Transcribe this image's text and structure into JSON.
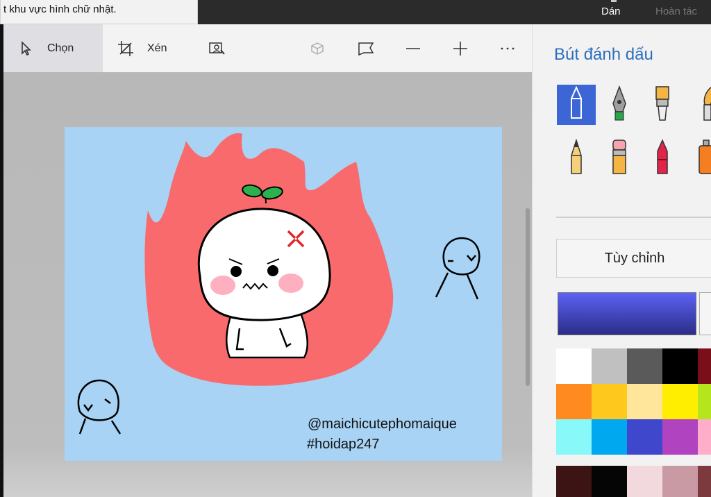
{
  "tooltip": {
    "text": "t khu vực hình chữ nhật."
  },
  "topbar": {
    "paste_label": "Dán",
    "undo_label": "Hoàn tác"
  },
  "toolbar": {
    "select_label": "Chọn",
    "crop_label": "Xén"
  },
  "canvas": {
    "watermark_line1": "@maichicutephomaique",
    "watermark_line2": "#hoidap247"
  },
  "panel": {
    "title": "Bút đánh dấu",
    "brushes": [
      "marker",
      "calligraphy-pen",
      "oil-brush",
      "watercolor-brush",
      "pencil",
      "eraser",
      "crayon",
      "spray-can"
    ],
    "customize_label": "Tùy chỉnh",
    "current_color": "#4a50d8",
    "palette": [
      [
        "#ffffff",
        "#c0c0c0",
        "#5a5a5a",
        "#000000",
        "#7a0f1a"
      ],
      [
        "#ff8a20",
        "#ffc81c",
        "#ffe69a",
        "#ffee00",
        "#b5e61d"
      ],
      [
        "#88f8f8",
        "#00a8f0",
        "#3f48cc",
        "#b043c0",
        "#ffaec9"
      ],
      [
        "#3d1414",
        "#050505",
        "#f2d9de",
        "#c99aa4",
        "#7c3a3f"
      ]
    ]
  }
}
